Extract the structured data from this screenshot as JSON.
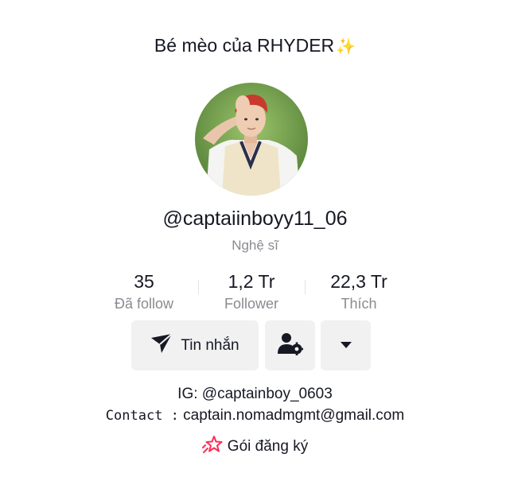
{
  "profile": {
    "nickname": "Bé mèo của RHYDER",
    "nickname_emoji": "✨",
    "username": "@captaiinboyy11_06",
    "role": "Nghệ sĩ"
  },
  "stats": [
    {
      "value": "35",
      "label": "Đã follow"
    },
    {
      "value": "1,2 Tr",
      "label": "Follower"
    },
    {
      "value": "22,3 Tr",
      "label": "Thích"
    }
  ],
  "actions": {
    "message_label": "Tin nhắn",
    "message_icon": "send-icon",
    "friend_icon": "user-settings-icon",
    "more_icon": "caret-down-icon"
  },
  "bio": {
    "line1": "IG: @captainboy_0603",
    "contact_label": "Contact :",
    "contact_value": " captain.nomadmgmt@gmail.com"
  },
  "subscription": {
    "label": "Gói đăng ký",
    "icon": "star-rocket-icon"
  },
  "colors": {
    "text": "#161823",
    "muted": "#8a8b91",
    "button_bg": "#f1f1f2",
    "subscription_accent": "#fe2c55"
  }
}
